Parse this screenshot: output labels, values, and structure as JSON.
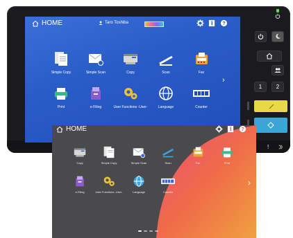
{
  "screen_top": {
    "home_label": "HOME",
    "user_name": "Taro Toshiba",
    "icons": [
      "gear-icon",
      "info-icon",
      "help-icon"
    ],
    "tiles": [
      {
        "label": "Simple Copy"
      },
      {
        "label": "Simple Scan"
      },
      {
        "label": "Copy"
      },
      {
        "label": "Scan"
      },
      {
        "label": "Fax"
      },
      {
        "label": "Print"
      },
      {
        "label": "e-Filing"
      },
      {
        "label": "User Functions -User-"
      },
      {
        "label": "Language"
      },
      {
        "label": "Counter"
      }
    ],
    "next_arrow": "›"
  },
  "side_panel": {
    "count_1": "1",
    "count_2": "2",
    "exclaim": "!"
  },
  "screen_bottom": {
    "home_label": "HOME",
    "tiles": [
      {
        "label": "Copy"
      },
      {
        "label": "Simple Copy"
      },
      {
        "label": "Simple Scan"
      },
      {
        "label": "Scan"
      },
      {
        "label": "Fax"
      },
      {
        "label": "Print"
      },
      {
        "label": "e-Filing"
      },
      {
        "label": "User Functions -User-"
      },
      {
        "label": "Language"
      },
      {
        "label": "Counter"
      }
    ],
    "next_arrow": "›",
    "page_dots": 4,
    "active_dot": 1
  },
  "colors": {
    "top_screen_blue": "#2a5cc8",
    "bottom_screen_gray": "#4a4a4d",
    "bottom_gradient": [
      "#f06a4a",
      "#e8507a",
      "#f0a040"
    ],
    "device_body": "#1b1b1d",
    "start_button": "#3aa6d8",
    "stop_button": "#e8d84a"
  }
}
